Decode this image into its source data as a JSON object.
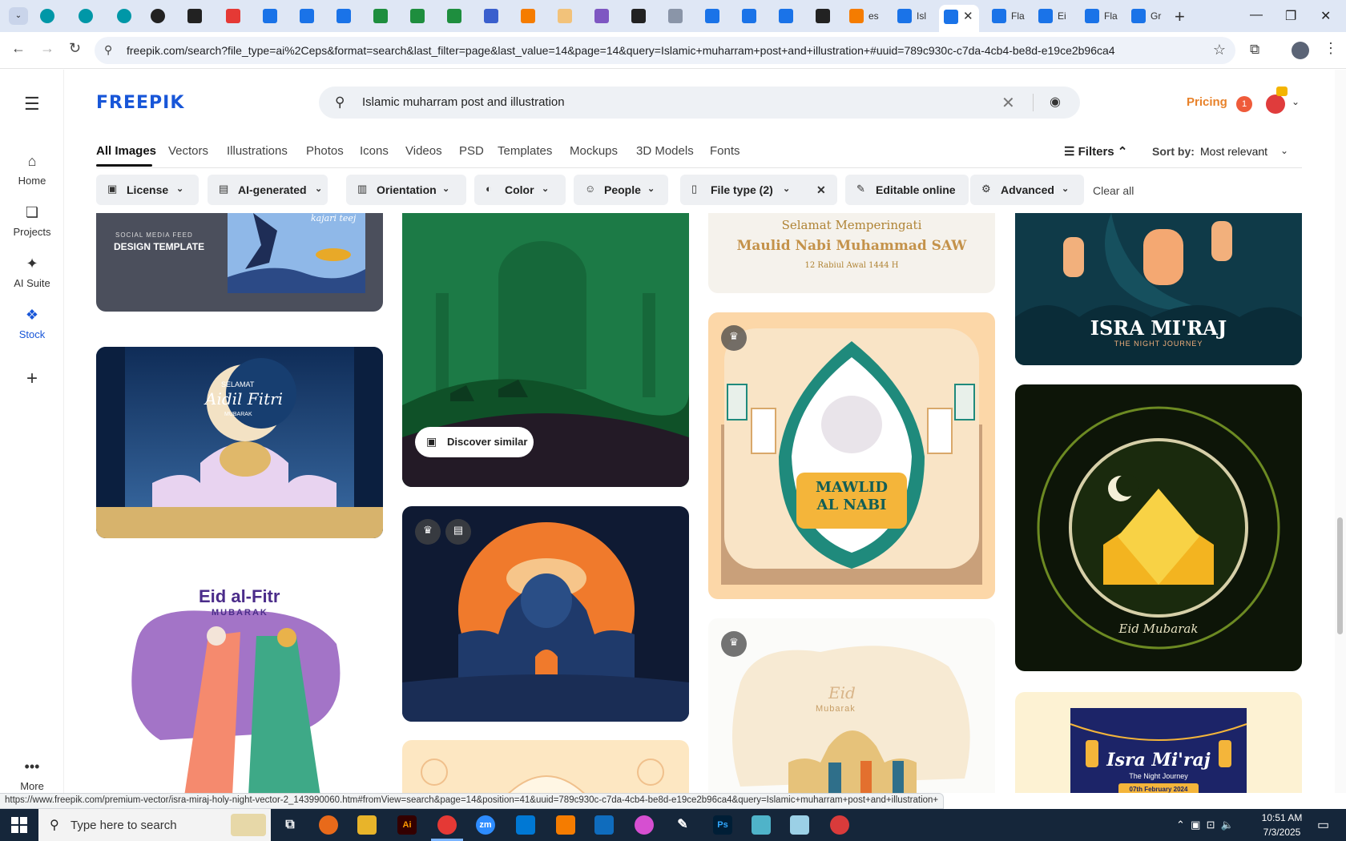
{
  "browser": {
    "tabs": [
      {
        "label": "es"
      },
      {
        "label": "Isl"
      },
      {
        "label": "Fla"
      },
      {
        "label": "Ei"
      },
      {
        "label": "Fla"
      },
      {
        "label": "Gr"
      }
    ],
    "url": "freepik.com/search?file_type=ai%2Ceps&format=search&last_filter=page&last_value=14&page=14&query=Islamic+muharram+post+and+illustration+#uuid=789c930c-c7da-4cb4-be8d-e19ce2b96ca4"
  },
  "sidebar": {
    "items": [
      {
        "label": "Home",
        "icon": "home-icon"
      },
      {
        "label": "Projects",
        "icon": "projects-icon"
      },
      {
        "label": "AI Suite",
        "icon": "sparkle-icon"
      },
      {
        "label": "Stock",
        "icon": "stock-icon"
      },
      {
        "label": "More",
        "icon": "more-icon"
      }
    ]
  },
  "header": {
    "logo": "FREEPIK",
    "search_query": "Islamic muharram post and illustration",
    "pricing": "Pricing",
    "notification_count": "1"
  },
  "categories": {
    "tabs": [
      "All Images",
      "Vectors",
      "Illustrations",
      "Photos",
      "Icons",
      "Videos",
      "PSD",
      "Templates",
      "Mockups",
      "3D Models",
      "Fonts"
    ],
    "active": "All Images",
    "filters_label": "Filters",
    "sort_label": "Sort by:",
    "sort_value": "Most relevant"
  },
  "filters": {
    "pills": [
      "License",
      "AI-generated",
      "Orientation",
      "Color",
      "People",
      "File type (2)",
      "Editable online",
      "Advanced"
    ],
    "clear_all": "Clear all"
  },
  "cards": {
    "design_template": {
      "line1": "SOCIAL MEDIA FEED",
      "line2": "DESIGN TEMPLATE",
      "tag": "kajari teej"
    },
    "maulid": {
      "line1": "Selamat Memperingati",
      "line2": "Maulid Nabi Muhammad SAW",
      "line3": "12 Rabiul Awal 1444 H"
    },
    "isra_miraj_1": {
      "title": "ISRA MI'RAJ",
      "subtitle": "THE NIGHT JOURNEY"
    },
    "aidil_fitri": {
      "line1": "SELAMAT",
      "line2": "Aidil Fitri",
      "line3": "MUBARAK"
    },
    "discover_similar": "Discover similar",
    "mawlid": {
      "line1": "MAWLID",
      "line2": "AL NABI"
    },
    "eid_mubarak": "Eid Mubarak",
    "eid_al_fitr": {
      "title": "Eid al-Fitr",
      "subtitle": "MUBARAK"
    },
    "eid_small": {
      "line1": "Eid",
      "line2": "Mubarak"
    },
    "isra_miraj_2": {
      "title": "Isra Mi'raj",
      "subtitle": "The Night Journey",
      "date": "07th February 2024"
    }
  },
  "status_url": "https://www.freepik.com/premium-vector/isra-miraj-holy-night-vector-2_143990060.htm#fromView=search&page=14&position=41&uuid=789c930c-c7da-4cb4-be8d-e19ce2b96ca4&query=Islamic+muharram+post+and+illustration+",
  "taskbar": {
    "search_placeholder": "Type here to search",
    "time": "10:51 AM",
    "date": "7/3/2025"
  }
}
